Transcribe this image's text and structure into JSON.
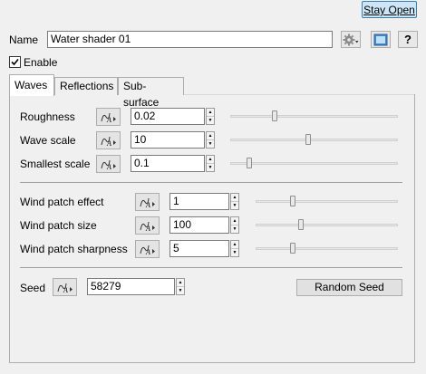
{
  "header": {
    "stay_open_label": "Stay Open"
  },
  "name": {
    "label": "Name",
    "value": "Water shader 01"
  },
  "enable": {
    "label": "Enable",
    "checked": true
  },
  "tabs": [
    {
      "label": "Waves",
      "active": true
    },
    {
      "label": "Reflections",
      "active": false
    },
    {
      "label": "Sub-surface",
      "active": false
    }
  ],
  "params": {
    "roughness": {
      "label": "Roughness",
      "value": "0.02",
      "slider": 0.26
    },
    "wave_scale": {
      "label": "Wave scale",
      "value": "10",
      "slider": 0.47
    },
    "smallest_scale": {
      "label": "Smallest scale",
      "value": "0.1",
      "slider": 0.1
    },
    "wind_patch_effect": {
      "label": "Wind patch effect",
      "value": "1",
      "slider": 0.25
    },
    "wind_patch_size": {
      "label": "Wind patch size",
      "value": "100",
      "slider": 0.3
    },
    "wind_patch_sharpness": {
      "label": "Wind patch sharpness",
      "value": "5",
      "slider": 0.25
    }
  },
  "seed": {
    "label": "Seed",
    "value": "58279",
    "random_label": "Random Seed"
  },
  "icons": [
    "gear-dropdown-icon",
    "preview-icon",
    "help-icon",
    "curve-edit-icon"
  ]
}
